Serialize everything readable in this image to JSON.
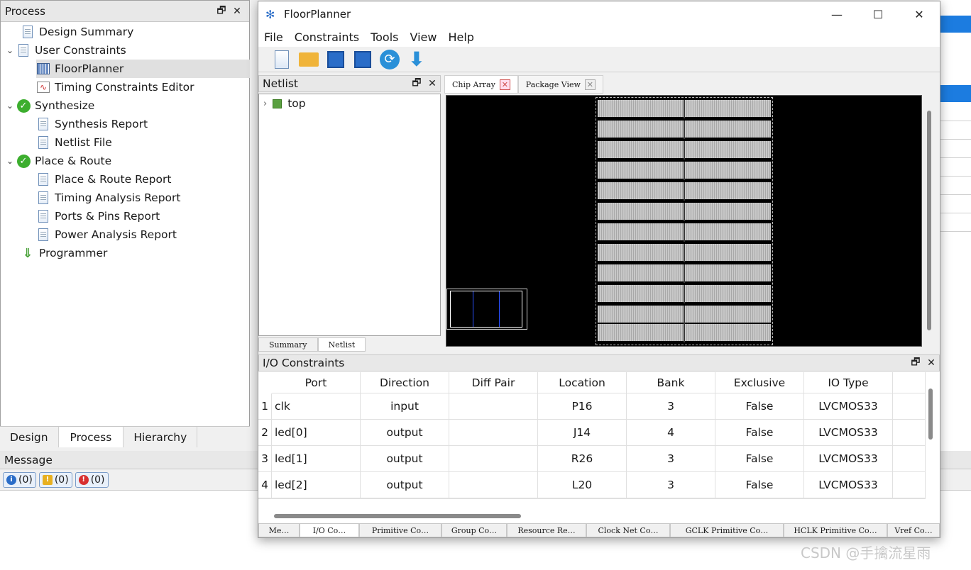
{
  "process": {
    "title": "Process",
    "items": [
      {
        "label": "Design Summary",
        "icon": "document-icon"
      },
      {
        "label": "User Constraints",
        "icon": "constraints-icon"
      },
      {
        "label": "FloorPlanner",
        "icon": "floorplanner-icon"
      },
      {
        "label": "Timing Constraints Editor",
        "icon": "timing-chart-icon"
      },
      {
        "label": "Synthesize",
        "icon": "check-icon"
      },
      {
        "label": "Synthesis Report",
        "icon": "document-icon"
      },
      {
        "label": "Netlist File",
        "icon": "document-icon"
      },
      {
        "label": "Place & Route",
        "icon": "check-icon"
      },
      {
        "label": "Place & Route Report",
        "icon": "document-icon"
      },
      {
        "label": "Timing Analysis Report",
        "icon": "document-icon"
      },
      {
        "label": "Ports & Pins Report",
        "icon": "document-icon"
      },
      {
        "label": "Power Analysis Report",
        "icon": "document-icon"
      },
      {
        "label": "Programmer",
        "icon": "programmer-icon"
      }
    ],
    "tabs": [
      "Design",
      "Process",
      "Hierarchy"
    ]
  },
  "message": {
    "title": "Message",
    "info": "(0)",
    "warning": "(0)",
    "error": "(0)"
  },
  "floorplanner": {
    "title": "FloorPlanner",
    "menu": [
      "File",
      "Constraints",
      "Tools",
      "View",
      "Help"
    ],
    "netlist": {
      "title": "Netlist",
      "root": "top",
      "tabs": [
        "Summary",
        "Netlist"
      ]
    },
    "chip_tabs": [
      "Chip Array",
      "Package View"
    ],
    "io": {
      "title": "I/O Constraints",
      "columns": [
        "Port",
        "Direction",
        "Diff Pair",
        "Location",
        "Bank",
        "Exclusive",
        "IO Type"
      ],
      "rows": [
        {
          "n": "1",
          "port": "clk",
          "direction": "input",
          "diff": "",
          "location": "P16",
          "bank": "3",
          "exclusive": "False",
          "iotype": "LVCMOS33"
        },
        {
          "n": "2",
          "port": "led[0]",
          "direction": "output",
          "diff": "",
          "location": "J14",
          "bank": "4",
          "exclusive": "False",
          "iotype": "LVCMOS33"
        },
        {
          "n": "3",
          "port": "led[1]",
          "direction": "output",
          "diff": "",
          "location": "R26",
          "bank": "3",
          "exclusive": "False",
          "iotype": "LVCMOS33"
        },
        {
          "n": "4",
          "port": "led[2]",
          "direction": "output",
          "diff": "",
          "location": "L20",
          "bank": "3",
          "exclusive": "False",
          "iotype": "LVCMOS33"
        }
      ],
      "bottom_tabs": [
        "Me…",
        "I/O Co…",
        "Primitive Co…",
        "Group Co…",
        "Resource Re…",
        "Clock Net Co…",
        "GCLK Primitive Co…",
        "HCLK Primitive Co…",
        "Vref Co…"
      ]
    }
  },
  "watermark": "CSDN @手擒流星雨",
  "colors": {
    "accent": "#1c7ce0",
    "check": "#3cae2e",
    "close_red": "#d05050"
  }
}
